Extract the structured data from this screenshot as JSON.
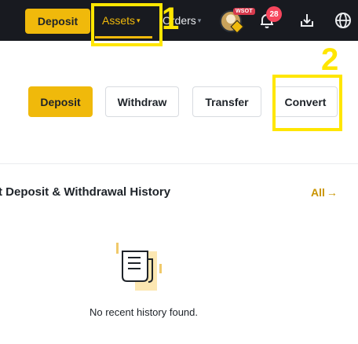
{
  "topbar": {
    "deposit_label": "Deposit",
    "assets_label": "Assets",
    "orders_label": "Orders",
    "caret": "▾",
    "vip_badge": "WSOT",
    "notification_count": "28",
    "accent": "#f0b90b",
    "background": "#181a20"
  },
  "annotations": {
    "one": "1",
    "two": "2",
    "color": "#ffe600"
  },
  "actions": {
    "deposit": "Deposit",
    "withdraw": "Withdraw",
    "transfer": "Transfer",
    "convert": "Convert"
  },
  "history": {
    "title": "t Deposit & Withdrawal History",
    "all_link": "All",
    "all_arrow": "→",
    "empty_message": "No recent history found."
  }
}
